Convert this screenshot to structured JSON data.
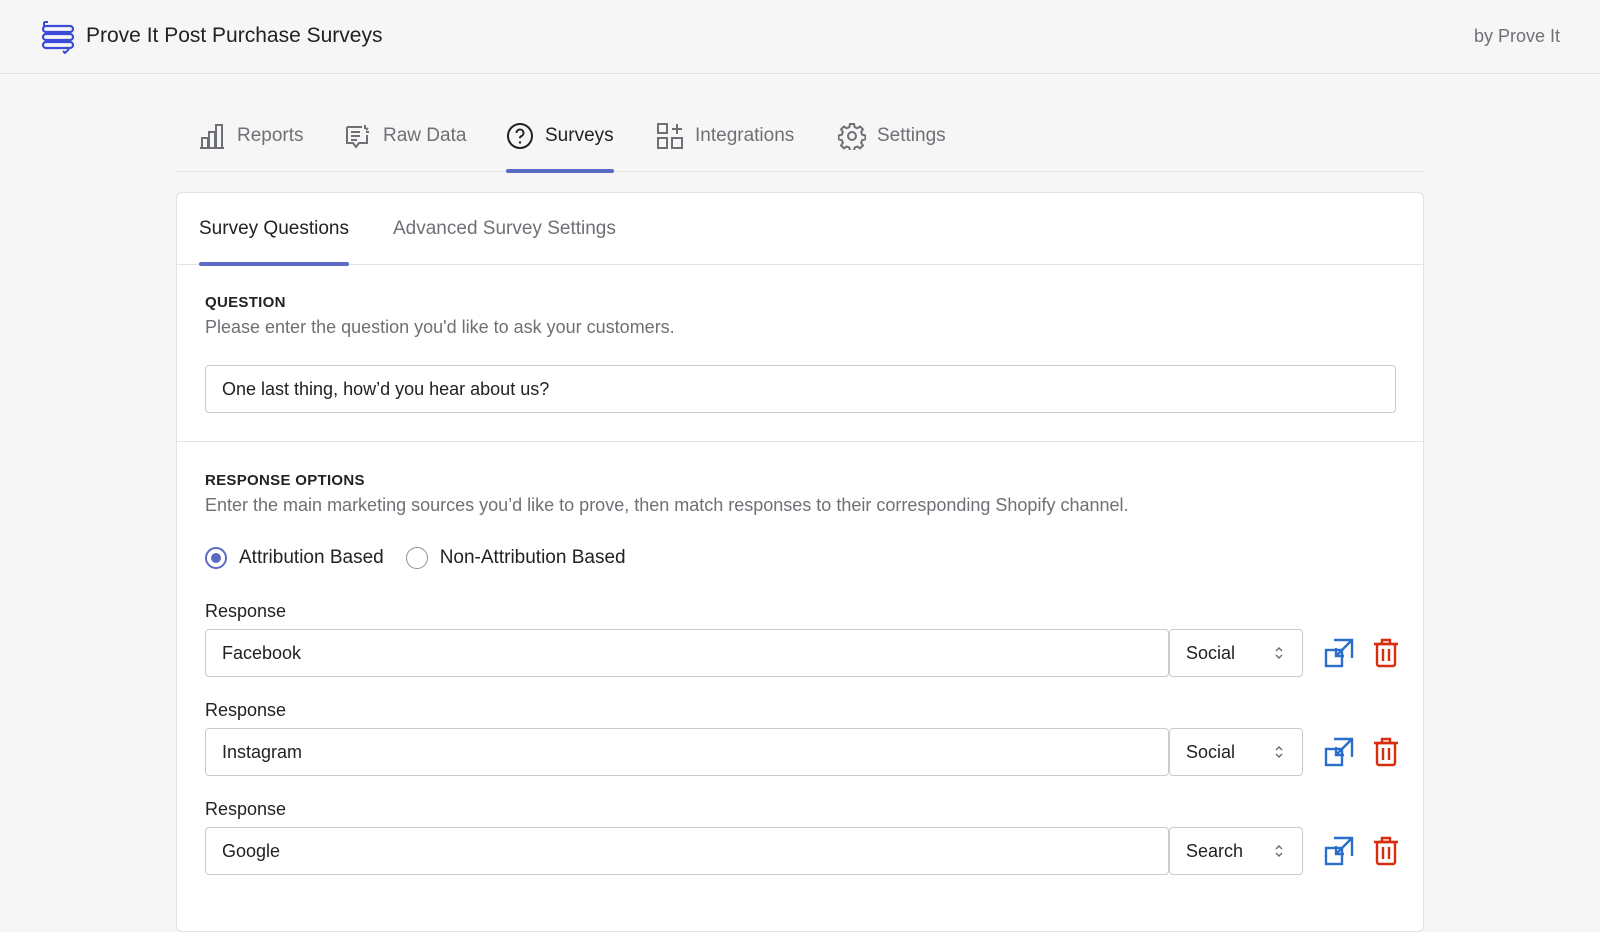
{
  "app": {
    "title": "Prove It Post Purchase Surveys",
    "by_line": "by Prove It"
  },
  "main_tabs": [
    {
      "label": "Reports",
      "icon": "bar-chart-icon"
    },
    {
      "label": "Raw Data",
      "icon": "raw-data-icon"
    },
    {
      "label": "Surveys",
      "icon": "question-circle-icon",
      "active": true
    },
    {
      "label": "Integrations",
      "icon": "integrations-icon"
    },
    {
      "label": "Settings",
      "icon": "gear-icon"
    }
  ],
  "sub_tabs": [
    {
      "label": "Survey Questions",
      "active": true
    },
    {
      "label": "Advanced Survey Settings"
    }
  ],
  "question": {
    "heading": "QUESTION",
    "help": "Please enter the question you'd like to ask your customers.",
    "value": "One last thing, how’d you hear about us?"
  },
  "response_options": {
    "heading": "RESPONSE OPTIONS",
    "help": "Enter the main marketing sources you’d like to prove, then match responses to their corresponding Shopify channel.",
    "mode_options": [
      "Attribution Based",
      "Non-Attribution Based"
    ],
    "selected_mode": "Attribution Based"
  },
  "responses": [
    {
      "label": "Response",
      "value": "Facebook",
      "channel": "Social"
    },
    {
      "label": "Response",
      "value": "Instagram",
      "channel": "Social"
    },
    {
      "label": "Response",
      "value": "Google",
      "channel": "Search"
    }
  ],
  "colors": {
    "accent": "#5c6ac4",
    "link_icon": "#2c6ecb",
    "delete_icon": "#d82c0d"
  }
}
